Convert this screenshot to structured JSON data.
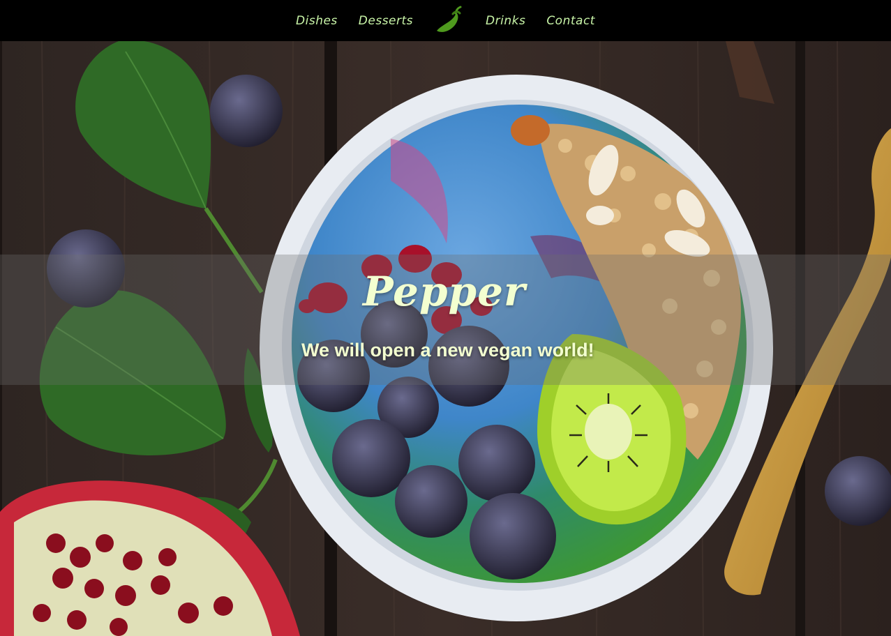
{
  "nav": {
    "items": [
      {
        "label": "Dishes"
      },
      {
        "label": "Desserts"
      },
      {
        "label": "Drinks"
      },
      {
        "label": "Contact"
      }
    ],
    "logo_icon": "chili-pepper-icon"
  },
  "hero": {
    "title": "Pepper",
    "subtitle": "We will open a new vegan world!",
    "image": "smoothie-bowl-photo"
  },
  "colors": {
    "nav_bg": "#000000",
    "nav_text": "#c9f5a8",
    "title_text": "#f3ffd0",
    "logo_green": "#4f9a1e"
  }
}
